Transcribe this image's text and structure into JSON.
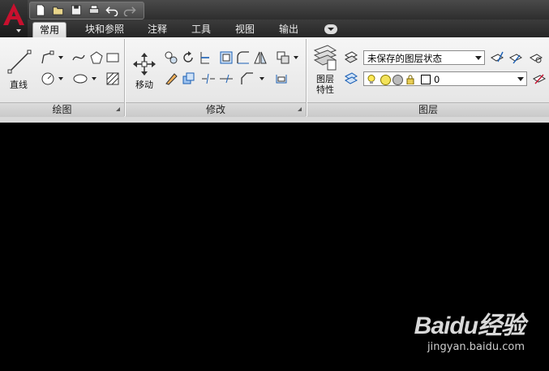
{
  "app": {
    "logo_letter": "A"
  },
  "quick_access": [
    "new-icon",
    "open-icon",
    "save-icon",
    "plot-icon",
    "undo-icon",
    "redo-icon"
  ],
  "tabs": [
    {
      "label": "常用",
      "active": true
    },
    {
      "label": "块和参照",
      "active": false
    },
    {
      "label": "注释",
      "active": false
    },
    {
      "label": "工具",
      "active": false
    },
    {
      "label": "视图",
      "active": false
    },
    {
      "label": "输出",
      "active": false
    }
  ],
  "panels": {
    "draw": {
      "title": "绘图",
      "line_label": "直线"
    },
    "modify": {
      "title": "修改",
      "move_label": "移动"
    },
    "layers": {
      "title": "图层",
      "properties_label_1": "图层",
      "properties_label_2": "特性",
      "layer_state": "未保存的图层状态",
      "current_layer": "0"
    }
  },
  "colors": {
    "accent_red": "#c8102e",
    "ribbon_bg": "#ececec",
    "canvas_bg": "#000000"
  },
  "watermark": {
    "brand": "Baidu经验",
    "url": "jingyan.baidu.com"
  }
}
